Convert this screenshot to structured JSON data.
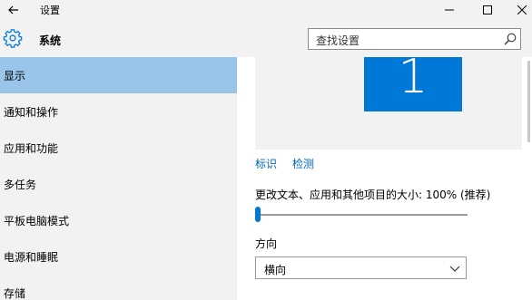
{
  "window": {
    "title": "设置",
    "back_icon": "arrow-left-icon",
    "controls": [
      "minimize-icon",
      "maximize-icon",
      "close-icon"
    ]
  },
  "header": {
    "icon": "gear-icon",
    "title": "系统",
    "search": {
      "placeholder": "查找设置",
      "icon": "search-icon"
    }
  },
  "sidebar": {
    "items": [
      {
        "label": "显示",
        "active": true
      },
      {
        "label": "通知和操作"
      },
      {
        "label": "应用和功能"
      },
      {
        "label": "多任务"
      },
      {
        "label": "平板电脑模式"
      },
      {
        "label": "电源和睡眠"
      },
      {
        "label": "存储"
      }
    ]
  },
  "display": {
    "monitor_number": "1",
    "identify_link": "标识",
    "detect_link": "检测",
    "scale_label": "更改文本、应用和其他项目的大小: 100% (推荐)",
    "scale_slider_value": 0,
    "orientation_label": "方向",
    "orientation_value": "横向"
  },
  "colors": {
    "accent": "#0078d7",
    "active_nav": "#99c5ea",
    "link": "#0067b8"
  }
}
